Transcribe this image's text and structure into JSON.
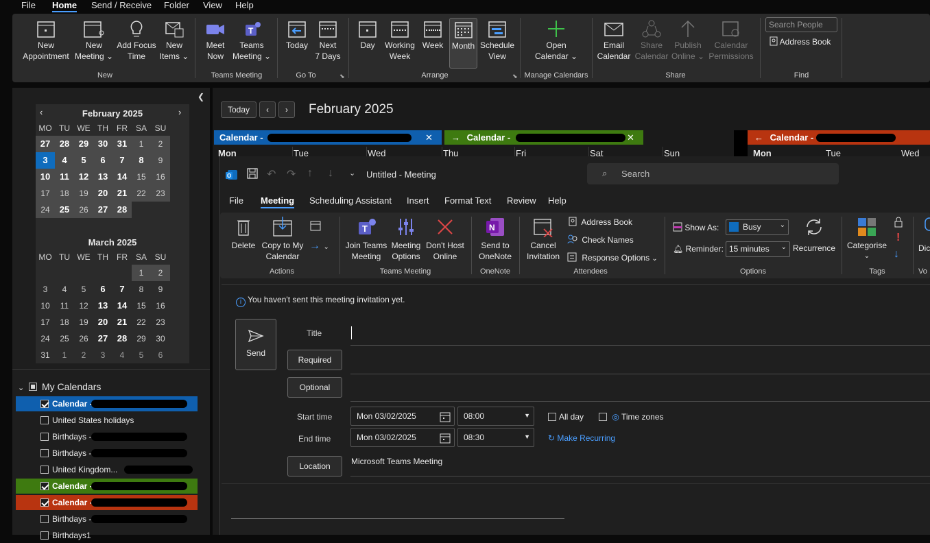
{
  "menu": {
    "file": "File",
    "home": "Home",
    "send_receive": "Send / Receive",
    "folder": "Folder",
    "view": "View",
    "help": "Help"
  },
  "ribbon": {
    "new_appointment": [
      "New",
      "Appointment"
    ],
    "new_meeting": [
      "New",
      "Meeting"
    ],
    "add_focus_time": [
      "Add Focus",
      "Time"
    ],
    "new_items": [
      "New",
      "Items"
    ],
    "group_new": "New",
    "meet_now": [
      "Meet",
      "Now"
    ],
    "teams_meeting": [
      "Teams",
      "Meeting"
    ],
    "group_teams": "Teams Meeting",
    "today": "Today",
    "next7": [
      "Next",
      "7 Days"
    ],
    "group_goto": "Go To",
    "day": "Day",
    "working_week": [
      "Working",
      "Week"
    ],
    "week": "Week",
    "month": "Month",
    "schedule_view": [
      "Schedule",
      "View"
    ],
    "group_arrange": "Arrange",
    "open_calendar": [
      "Open",
      "Calendar"
    ],
    "group_manage": "Manage Calendars",
    "email_calendar": [
      "Email",
      "Calendar"
    ],
    "share_calendar": [
      "Share",
      "Calendar"
    ],
    "publish_online": [
      "Publish",
      "Online"
    ],
    "calendar_permissions": [
      "Calendar",
      "Permissions"
    ],
    "group_share": "Share",
    "search_people": "Search People",
    "address_book": "Address Book",
    "group_find": "Find"
  },
  "feb": {
    "title": "February 2025",
    "dow": [
      "MO",
      "TU",
      "WE",
      "TH",
      "FR",
      "SA",
      "SU"
    ],
    "rows": [
      [
        "27",
        "28",
        "29",
        "30",
        "31",
        "1",
        "2"
      ],
      [
        "3",
        "4",
        "5",
        "6",
        "7",
        "8",
        "9"
      ],
      [
        "10",
        "11",
        "12",
        "13",
        "14",
        "15",
        "16"
      ],
      [
        "17",
        "18",
        "19",
        "20",
        "21",
        "22",
        "23"
      ],
      [
        "24",
        "25",
        "26",
        "27",
        "28"
      ]
    ]
  },
  "mar": {
    "title": "March 2025",
    "dow": [
      "MO",
      "TU",
      "WE",
      "TH",
      "FR",
      "SA",
      "SU"
    ],
    "rows": [
      [
        "",
        "",
        "",
        "",
        "",
        "1",
        "2"
      ],
      [
        "3",
        "4",
        "5",
        "6",
        "7",
        "8",
        "9"
      ],
      [
        "10",
        "11",
        "12",
        "13",
        "14",
        "15",
        "16"
      ],
      [
        "17",
        "18",
        "19",
        "20",
        "21",
        "22",
        "23"
      ],
      [
        "24",
        "25",
        "26",
        "27",
        "28",
        "29",
        "30"
      ],
      [
        "31",
        "1",
        "2",
        "3",
        "4",
        "5",
        "6"
      ]
    ]
  },
  "calendars": {
    "header": "My Calendars",
    "items": [
      {
        "label": "Calendar - ",
        "checked": true,
        "color": "#0f5fae"
      },
      {
        "label": "United States holidays",
        "checked": false,
        "color": ""
      },
      {
        "label": "Birthdays - ",
        "checked": false,
        "color": ""
      },
      {
        "label": "Birthdays - ",
        "checked": false,
        "color": ""
      },
      {
        "label": "United Kingdom...",
        "checked": false,
        "color": ""
      },
      {
        "label": "Calendar - ",
        "checked": true,
        "color": "#3e7a10"
      },
      {
        "label": "Calendar - ",
        "checked": true,
        "color": "#b83410"
      },
      {
        "label": "Birthdays - ",
        "checked": false,
        "color": ""
      },
      {
        "label": "Birthdays1",
        "checked": false,
        "color": ""
      }
    ]
  },
  "main": {
    "today": "Today",
    "title": "February 2025",
    "cal1": "Calendar - ",
    "cal2": "Calendar - ",
    "cal3": "Calendar - ",
    "days": [
      "Mon",
      "Tue",
      "Wed",
      "Thu",
      "Fri",
      "Sat",
      "Sun"
    ]
  },
  "meeting": {
    "title": "Untitled  -  Meeting",
    "search": "Search",
    "tabs": [
      "File",
      "Meeting",
      "Scheduling Assistant",
      "Insert",
      "Format Text",
      "Review",
      "Help"
    ],
    "delete": "Delete",
    "copy_to_calendar": [
      "Copy to My",
      "Calendar"
    ],
    "group_actions": "Actions",
    "join_teams": [
      "Join Teams",
      "Meeting"
    ],
    "meeting_options": [
      "Meeting",
      "Options"
    ],
    "dont_host": [
      "Don't Host",
      "Online"
    ],
    "group_teams": "Teams Meeting",
    "send_onenote": [
      "Send to",
      "OneNote"
    ],
    "group_onenote": "OneNote",
    "cancel_invitation": [
      "Cancel",
      "Invitation"
    ],
    "address_book": "Address Book",
    "check_names": "Check Names",
    "response_options": "Response Options",
    "group_attendees": "Attendees",
    "show_as_label": "Show As:",
    "show_as_value": "Busy",
    "reminder_label": "Reminder:",
    "reminder_value": "15 minutes",
    "recurrence": "Recurrence",
    "group_options": "Options",
    "categorise": "Categorise",
    "group_tags": "Tags",
    "dictate": "Dic",
    "group_voice": "Vo"
  },
  "form": {
    "info": "You haven't sent this meeting invitation yet.",
    "send": "Send",
    "title_label": "Title",
    "required": "Required",
    "optional": "Optional",
    "start_label": "Start time",
    "end_label": "End time",
    "start_date": "Mon 03/02/2025",
    "start_time": "08:00",
    "end_date": "Mon 03/02/2025",
    "end_time": "08:30",
    "all_day": "All day",
    "time_zones": "Time zones",
    "make_recurring": "Make Recurring",
    "location_btn": "Location",
    "location_value": "Microsoft Teams Meeting"
  },
  "colors": {
    "accent": "#4a9eff",
    "blue_cal": "#0f5fae",
    "green_cal": "#3e7a10",
    "red_cal": "#b83410",
    "teams": "#7b83eb",
    "onenote": "#7719aa"
  }
}
